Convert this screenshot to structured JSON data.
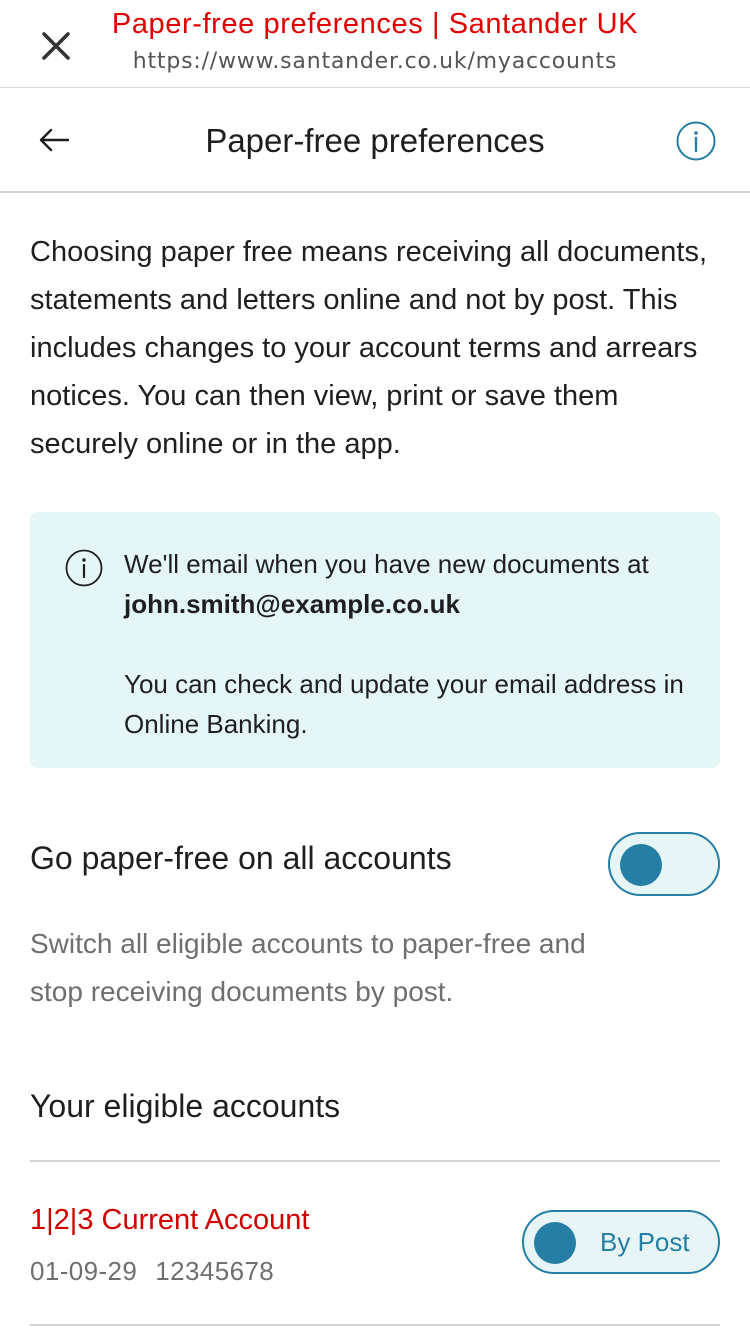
{
  "browser": {
    "title": "Paper-free preferences  |  Santander UK",
    "url": "https://www.santander.co.uk/myaccounts"
  },
  "header": {
    "title": "Paper-free preferences"
  },
  "intro": "Choosing paper free means receiving all documents, statements and letters online and not by post. This includes changes to your account terms and arrears notices. You can then view, print or save them securely online or in the app.",
  "notice": {
    "line1": "We'll email when you have new documents at",
    "email": "john.smith@example.co.uk",
    "line2": "You can check and update your email address in Online Banking."
  },
  "paper_free_all": {
    "label": "Go paper-free on all accounts",
    "description": "Switch all eligible accounts to paper-free and stop receiving documents by post.",
    "enabled": false
  },
  "eligible_accounts": {
    "heading": "Your eligible accounts",
    "items": [
      {
        "name": "1|2|3 Current Account",
        "sort_code": "01-09-29",
        "account_number": "12345678",
        "preference": "By Post"
      }
    ]
  },
  "colors": {
    "brand_red": "#e00000",
    "accent_teal": "#257fa4",
    "notice_bg": "#e5f6f6"
  }
}
